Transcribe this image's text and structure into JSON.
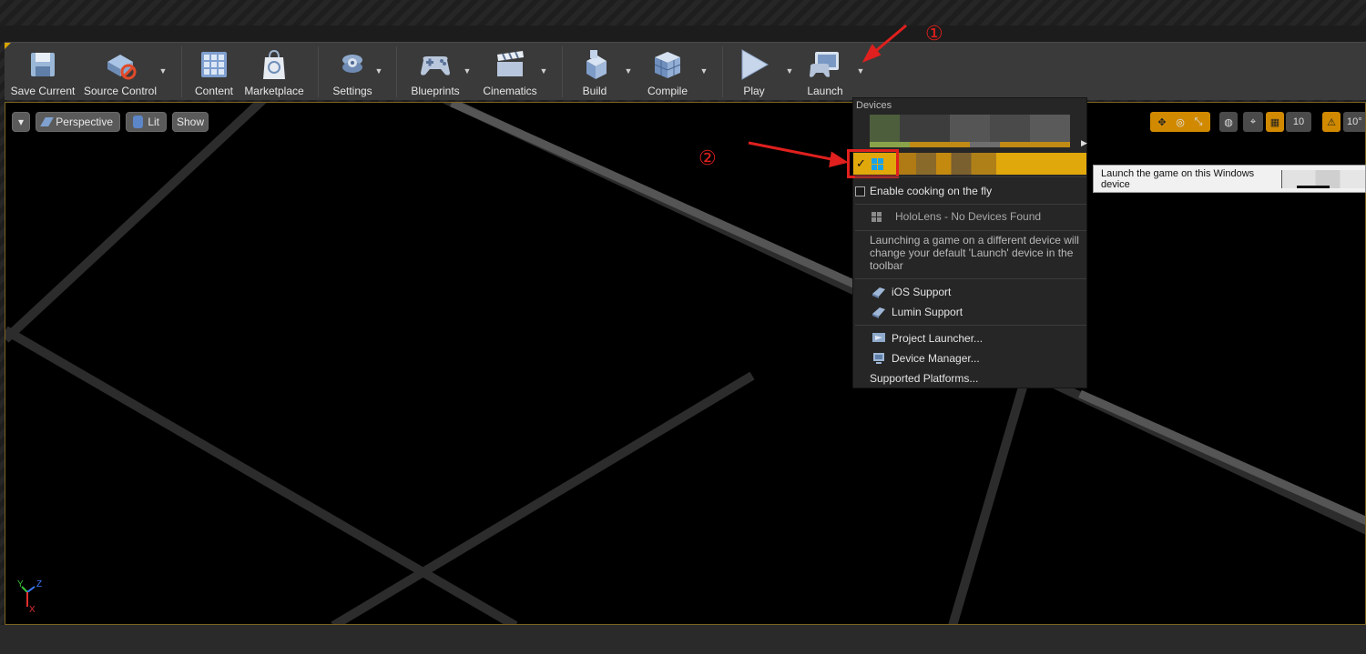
{
  "toolbar": {
    "buttons": [
      {
        "label": "Save Current"
      },
      {
        "label": "Source Control"
      },
      {
        "label": "Content"
      },
      {
        "label": "Marketplace"
      },
      {
        "label": "Settings"
      },
      {
        "label": "Blueprints"
      },
      {
        "label": "Cinematics"
      },
      {
        "label": "Build"
      },
      {
        "label": "Compile"
      },
      {
        "label": "Play"
      },
      {
        "label": "Launch"
      }
    ]
  },
  "viewport": {
    "menu_button": "▾",
    "perspective": "Perspective",
    "lit": "Lit",
    "show": "Show",
    "grid_snap_value": "10",
    "rotation_snap_value": "10°",
    "axis_labels": {
      "y": "Y",
      "z": "Z",
      "x": "X"
    }
  },
  "launch_menu": {
    "section_title": "Devices",
    "checked_mark": "✓",
    "enable_cooking": "Enable cooking on the fly",
    "hololens": "HoloLens - No Devices Found",
    "note": "Launching a game on a different device will change your default 'Launch' device in the toolbar",
    "ios_support": "iOS Support",
    "lumin_support": "Lumin Support",
    "project_launcher": "Project Launcher...",
    "device_manager": "Device Manager...",
    "supported_platforms": "Supported Platforms..."
  },
  "tooltip": {
    "text": "Launch the game on this Windows device"
  },
  "annotations": {
    "step1": "①",
    "step2": "②"
  },
  "colors": {
    "accent": "#e1a80c",
    "annotation": "#e0201e",
    "toolbar_bg": "#3a3a3a",
    "viewport_bg": "#000000"
  }
}
